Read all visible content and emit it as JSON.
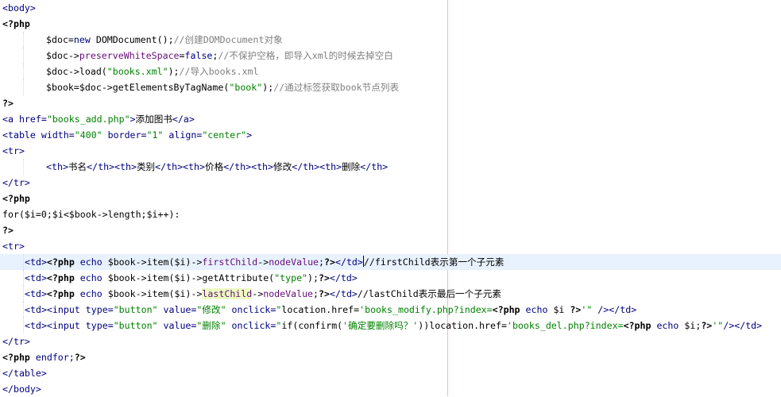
{
  "editor": {
    "current_line_index": 16,
    "caret": {
      "line": 16,
      "after_segment": 20
    },
    "lines": [
      {
        "indent": 0,
        "segments": [
          {
            "t": "<body>",
            "c": "tag"
          }
        ]
      },
      {
        "indent": 0,
        "segments": [
          {
            "t": "<?php",
            "c": "php"
          }
        ]
      },
      {
        "indent": 2,
        "segments": [
          {
            "t": "$doc",
            "c": "var"
          },
          {
            "t": "=",
            "c": "text"
          },
          {
            "t": "new",
            "c": "kw"
          },
          {
            "t": " DOMDocument();",
            "c": "fn"
          },
          {
            "t": "//创建DOMDocument对象",
            "c": "com"
          }
        ]
      },
      {
        "indent": 2,
        "segments": [
          {
            "t": "$doc",
            "c": "var"
          },
          {
            "t": "->",
            "c": "text"
          },
          {
            "t": "preserveWhiteSpace",
            "c": "prop"
          },
          {
            "t": "=",
            "c": "text"
          },
          {
            "t": "false",
            "c": "kw"
          },
          {
            "t": ";",
            "c": "text"
          },
          {
            "t": "//不保护空格，即导入xml的时候去掉空白",
            "c": "com"
          }
        ]
      },
      {
        "indent": 2,
        "segments": [
          {
            "t": "$doc",
            "c": "var"
          },
          {
            "t": "->load(",
            "c": "text"
          },
          {
            "t": "\"books.xml\"",
            "c": "str"
          },
          {
            "t": ");",
            "c": "text"
          },
          {
            "t": "//导入books.xml",
            "c": "com"
          }
        ]
      },
      {
        "indent": 2,
        "segments": [
          {
            "t": "$book",
            "c": "var"
          },
          {
            "t": "=",
            "c": "text"
          },
          {
            "t": "$doc",
            "c": "var"
          },
          {
            "t": "->getElementsByTagName(",
            "c": "text"
          },
          {
            "t": "\"book\"",
            "c": "str"
          },
          {
            "t": ");",
            "c": "text"
          },
          {
            "t": "//通过标签获取book节点列表",
            "c": "com"
          }
        ]
      },
      {
        "indent": 0,
        "segments": [
          {
            "t": "?>",
            "c": "php"
          }
        ]
      },
      {
        "indent": 0,
        "segments": [
          {
            "t": "<a href=",
            "c": "tag"
          },
          {
            "t": "\"books_add.php\"",
            "c": "attrval"
          },
          {
            "t": ">",
            "c": "tag"
          },
          {
            "t": "添加图书",
            "c": "text"
          },
          {
            "t": "</a>",
            "c": "tag"
          }
        ]
      },
      {
        "indent": 0,
        "segments": [
          {
            "t": "<table width=",
            "c": "tag"
          },
          {
            "t": "\"400\"",
            "c": "attrval"
          },
          {
            "t": " border=",
            "c": "tag"
          },
          {
            "t": "\"1\"",
            "c": "attrval"
          },
          {
            "t": " align=",
            "c": "tag"
          },
          {
            "t": "\"center\"",
            "c": "attrval"
          },
          {
            "t": ">",
            "c": "tag"
          }
        ]
      },
      {
        "indent": 0,
        "segments": [
          {
            "t": "<tr>",
            "c": "tag"
          }
        ]
      },
      {
        "indent": 2,
        "segments": [
          {
            "t": "<th>",
            "c": "tag"
          },
          {
            "t": "书名",
            "c": "text"
          },
          {
            "t": "</th><th>",
            "c": "tag"
          },
          {
            "t": "类别",
            "c": "text"
          },
          {
            "t": "</th><th>",
            "c": "tag"
          },
          {
            "t": "价格",
            "c": "text"
          },
          {
            "t": "</th><th>",
            "c": "tag"
          },
          {
            "t": "修改",
            "c": "text"
          },
          {
            "t": "</th><th>",
            "c": "tag"
          },
          {
            "t": "删除",
            "c": "text"
          },
          {
            "t": "</th>",
            "c": "tag"
          }
        ]
      },
      {
        "indent": 0,
        "segments": [
          {
            "t": "</tr>",
            "c": "tag"
          }
        ]
      },
      {
        "indent": 0,
        "segments": [
          {
            "t": "<?php",
            "c": "php"
          }
        ]
      },
      {
        "indent": 0,
        "segments": [
          {
            "t": "for(",
            "c": "text"
          },
          {
            "t": "$i",
            "c": "var"
          },
          {
            "t": "=0;",
            "c": "text"
          },
          {
            "t": "$i",
            "c": "var"
          },
          {
            "t": "<",
            "c": "text"
          },
          {
            "t": "$book",
            "c": "var"
          },
          {
            "t": "->length;",
            "c": "text"
          },
          {
            "t": "$i",
            "c": "var"
          },
          {
            "t": "++):",
            "c": "text"
          }
        ]
      },
      {
        "indent": 0,
        "segments": [
          {
            "t": "?>",
            "c": "php"
          }
        ]
      },
      {
        "indent": 0,
        "segments": [
          {
            "t": "<tr>",
            "c": "tag"
          }
        ]
      },
      {
        "indent": 1,
        "segments": [
          {
            "t": "<td>",
            "c": "tag"
          },
          {
            "t": "<?php",
            "c": "php"
          },
          {
            "t": " echo ",
            "c": "kw"
          },
          {
            "t": "$book",
            "c": "var"
          },
          {
            "t": "->item(",
            "c": "text"
          },
          {
            "t": "$i",
            "c": "var"
          },
          {
            "t": ")->",
            "c": "text"
          },
          {
            "t": "firstChild",
            "c": "prop"
          },
          {
            "t": "->",
            "c": "text"
          },
          {
            "t": "nodeValue",
            "c": "prop"
          },
          {
            "t": ";",
            "c": "text"
          },
          {
            "t": "?>",
            "c": "php"
          },
          {
            "t": "</td>",
            "c": "tag"
          },
          {
            "t": "//",
            "c": "text"
          },
          {
            "t": "firstChild表示第一个子元素",
            "c": "text"
          }
        ]
      },
      {
        "indent": 1,
        "segments": [
          {
            "t": "<td>",
            "c": "tag"
          },
          {
            "t": "<?php",
            "c": "php"
          },
          {
            "t": " echo ",
            "c": "kw"
          },
          {
            "t": "$book",
            "c": "var"
          },
          {
            "t": "->item(",
            "c": "text"
          },
          {
            "t": "$i",
            "c": "var"
          },
          {
            "t": ")->getAttribute(",
            "c": "text"
          },
          {
            "t": "\"type\"",
            "c": "str"
          },
          {
            "t": ");",
            "c": "text"
          },
          {
            "t": "?>",
            "c": "php"
          },
          {
            "t": "</td>",
            "c": "tag"
          }
        ]
      },
      {
        "indent": 1,
        "segments": [
          {
            "t": "<td>",
            "c": "tag"
          },
          {
            "t": "<?php",
            "c": "php"
          },
          {
            "t": " echo ",
            "c": "kw"
          },
          {
            "t": "$book",
            "c": "var"
          },
          {
            "t": "->item(",
            "c": "text"
          },
          {
            "t": "$i",
            "c": "var"
          },
          {
            "t": ")->",
            "c": "text"
          },
          {
            "t": "lastChild",
            "c": "prop",
            "hl": true
          },
          {
            "t": "->",
            "c": "text"
          },
          {
            "t": "nodeValue",
            "c": "prop"
          },
          {
            "t": ";",
            "c": "text"
          },
          {
            "t": "?>",
            "c": "php"
          },
          {
            "t": "</td>",
            "c": "tag"
          },
          {
            "t": "//lastChild表示最后一个子元素",
            "c": "text"
          }
        ]
      },
      {
        "indent": 1,
        "segments": [
          {
            "t": "<td><input type=",
            "c": "tag"
          },
          {
            "t": "\"button\"",
            "c": "attrval"
          },
          {
            "t": " value=",
            "c": "tag"
          },
          {
            "t": "\"修改\"",
            "c": "attrval"
          },
          {
            "t": " onclick=",
            "c": "tag"
          },
          {
            "t": "\"",
            "c": "attrval"
          },
          {
            "t": "location.href=",
            "c": "text"
          },
          {
            "t": "'books_modify.php?index=",
            "c": "attrval"
          },
          {
            "t": "<?php",
            "c": "php"
          },
          {
            "t": " echo ",
            "c": "kw"
          },
          {
            "t": "$i ",
            "c": "var"
          },
          {
            "t": "?>",
            "c": "php"
          },
          {
            "t": "'\"",
            "c": "attrval"
          },
          {
            "t": " />",
            "c": "tag"
          },
          {
            "t": "</td>",
            "c": "tag"
          }
        ]
      },
      {
        "indent": 1,
        "segments": [
          {
            "t": "<td><input type=",
            "c": "tag"
          },
          {
            "t": "\"button\"",
            "c": "attrval"
          },
          {
            "t": " value=",
            "c": "tag"
          },
          {
            "t": "\"删除\"",
            "c": "attrval"
          },
          {
            "t": " onclick=",
            "c": "tag"
          },
          {
            "t": "\"",
            "c": "attrval"
          },
          {
            "t": "if(confirm(",
            "c": "text"
          },
          {
            "t": "'确定要删除吗？'",
            "c": "attrval"
          },
          {
            "t": "))location.href=",
            "c": "text"
          },
          {
            "t": "'books_del.php?index=",
            "c": "attrval"
          },
          {
            "t": "<?php",
            "c": "php"
          },
          {
            "t": " echo ",
            "c": "kw"
          },
          {
            "t": "$i;",
            "c": "var"
          },
          {
            "t": "?>",
            "c": "php"
          },
          {
            "t": "'\"",
            "c": "attrval"
          },
          {
            "t": "/>",
            "c": "tag"
          },
          {
            "t": "</td>",
            "c": "tag"
          }
        ]
      },
      {
        "indent": 0,
        "segments": [
          {
            "t": "</tr>",
            "c": "tag"
          }
        ]
      },
      {
        "indent": 0,
        "segments": [
          {
            "t": "<?php",
            "c": "php"
          },
          {
            "t": " endfor;",
            "c": "kw"
          },
          {
            "t": "?>",
            "c": "php"
          }
        ]
      },
      {
        "indent": 0,
        "segments": [
          {
            "t": "</table>",
            "c": "tag"
          }
        ]
      },
      {
        "indent": 0,
        "segments": [
          {
            "t": "</body>",
            "c": "tag"
          }
        ]
      }
    ]
  }
}
